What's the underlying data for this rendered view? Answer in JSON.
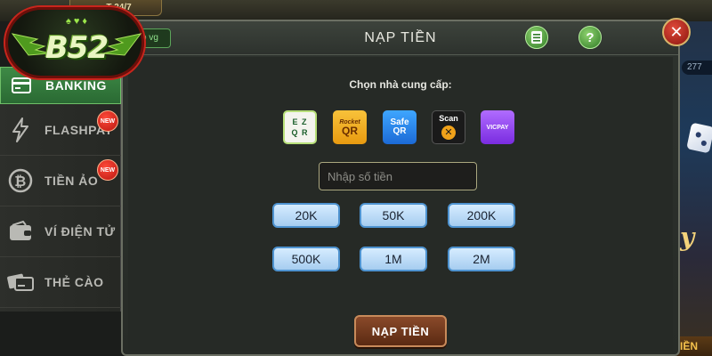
{
  "top_badge": "...T 24/7",
  "right_counter": "277",
  "right_bottom_label": "IỀN",
  "logo": {
    "text": "B52",
    "suits": "♠ ♥ ♦"
  },
  "sidebar": {
    "items": [
      {
        "label": "BANKING",
        "icon": "bank-card-icon",
        "active": true,
        "badge": ""
      },
      {
        "label": "FLASHPAY",
        "icon": "lightning-icon",
        "active": false,
        "badge": "NEW"
      },
      {
        "label": "TIỀN ẢO",
        "icon": "bitcoin-icon",
        "active": false,
        "badge": "NEW"
      },
      {
        "label": "VÍ ĐIỆN TỬ",
        "icon": "wallet-icon",
        "active": false,
        "badge": ""
      },
      {
        "label": "THẺ CÀO",
        "icon": "card-icon",
        "active": false,
        "badge": ""
      }
    ]
  },
  "dialog": {
    "title": "NẠP TIỀN",
    "tag": "b vg",
    "provider_label": "Chọn nhà cung cấp:",
    "providers": [
      {
        "name": "EZ QR",
        "line1": "E Z",
        "line2": "Q R"
      },
      {
        "name": "Rocket QR",
        "line1": "Rocket",
        "line2": "QR"
      },
      {
        "name": "Safe QR",
        "line1": "Safe",
        "line2": "QR"
      },
      {
        "name": "Scan",
        "line1": "Scan",
        "line2": "✕"
      },
      {
        "name": "VICPAY",
        "line1": "VICPAY",
        "line2": ""
      }
    ],
    "amount_placeholder": "Nhập số tiền",
    "amounts": [
      "20K",
      "50K",
      "200K",
      "500K",
      "1M",
      "2M"
    ],
    "submit_label": "NẠP TIỀN"
  },
  "colors": {
    "active_tab": "#3e8a46",
    "amount_button": "#a6cdf0",
    "submit_button": "#8a4a2a",
    "close_button": "#c0281c"
  }
}
